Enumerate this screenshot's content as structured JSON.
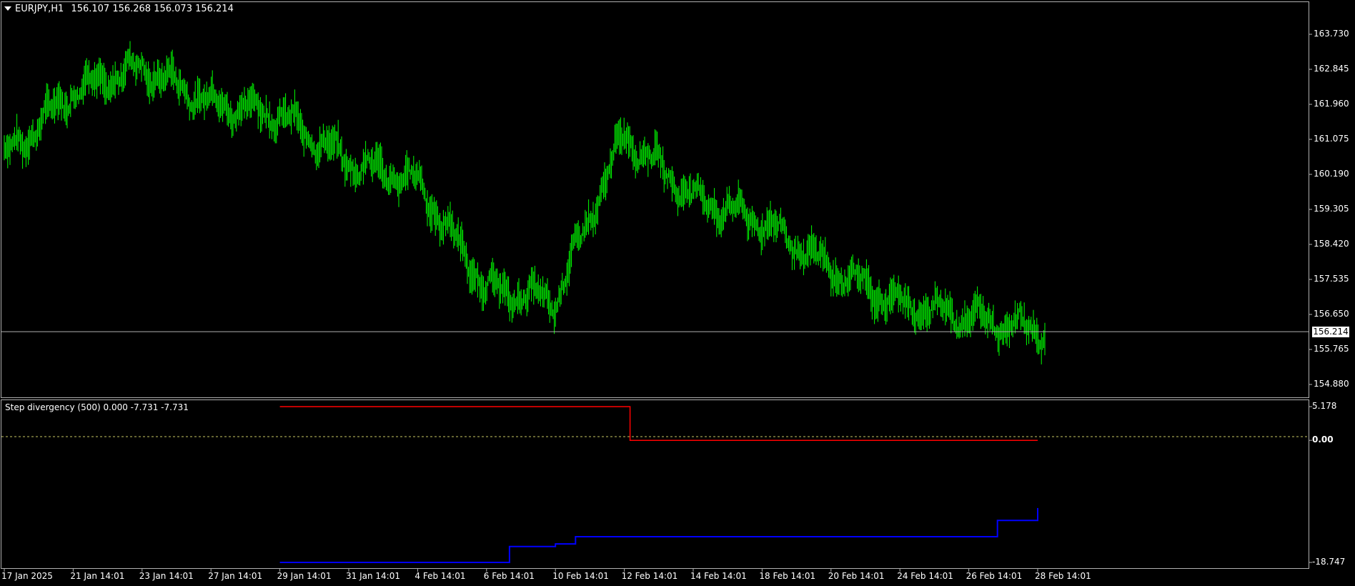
{
  "header": {
    "symbol": "EURJPY,H1",
    "ohlc": "156.107 156.268 156.073 156.214"
  },
  "indicator": {
    "title": "Step divergency (500) 0.000 -7.731 -7.731"
  },
  "colors": {
    "background": "#000000",
    "candles": "#00ff00",
    "upper_line": "#ff0000",
    "lower_line": "#0000ff",
    "grid": "#b0b0b0",
    "zero_line": "#c8c864"
  },
  "price_axis": {
    "ticks": [
      "163.730",
      "162.845",
      "161.960",
      "161.075",
      "160.190",
      "159.305",
      "158.420",
      "157.535",
      "156.650",
      "155.765",
      "154.880"
    ],
    "current_price": "156.214"
  },
  "indicator_axis": {
    "ticks": [
      "5.178",
      "0.00",
      "-18.747"
    ]
  },
  "time_axis": {
    "ticks": [
      "17 Jan 2025",
      "21 Jan 14:01",
      "23 Jan 14:01",
      "27 Jan 14:01",
      "29 Jan 14:01",
      "31 Jan 14:01",
      "4 Feb 14:01",
      "6 Feb 14:01",
      "10 Feb 14:01",
      "12 Feb 14:01",
      "14 Feb 14:01",
      "18 Feb 14:01",
      "20 Feb 14:01",
      "24 Feb 14:01",
      "26 Feb 14:01",
      "28 Feb 14:01"
    ]
  },
  "chart_data": [
    {
      "type": "line",
      "title": "EURJPY,H1",
      "series": [
        {
          "name": "EURJPY",
          "x": [
            "17 Jan 2025",
            "21 Jan 14:01",
            "23 Jan 14:01",
            "27 Jan 14:01",
            "29 Jan 14:01",
            "31 Jan 14:01",
            "4 Feb 14:01",
            "6 Feb 14:01",
            "10 Feb 14:01",
            "12 Feb 14:01",
            "14 Feb 14:01",
            "18 Feb 14:01",
            "20 Feb 14:01",
            "24 Feb 14:01",
            "26 Feb 14:01",
            "28 Feb 14:01"
          ],
          "values": [
            160.6,
            162.3,
            162.9,
            162.0,
            161.7,
            160.5,
            160.0,
            157.3,
            157.0,
            161.2,
            159.6,
            159.0,
            157.8,
            156.9,
            156.6,
            156.2
          ]
        }
      ],
      "ylim": [
        154.5,
        164.5
      ]
    },
    {
      "type": "line",
      "title": "Step divergency (500) 0.000 -7.731 -7.731",
      "series": [
        {
          "name": "",
          "x": [
            "29 Jan 14:01",
            "12 Feb 14:01",
            "12 Feb 18:00",
            "28 Feb 14:01"
          ],
          "values": [
            5.178,
            5.178,
            0.0,
            0.0
          ]
        },
        {
          "name": "",
          "x": [
            "29 Jan 14:01",
            "7 Feb 22:00",
            "10 Feb 14:01",
            "11 Feb 04:00",
            "26 Feb 14:01",
            "27 Feb 10:00",
            "28 Feb 14:01"
          ],
          "values": [
            -18.747,
            -16.3,
            -15.9,
            -14.8,
            -14.8,
            -12.3,
            -10.4
          ]
        }
      ],
      "ylim": [
        -18.747,
        5.178
      ]
    }
  ]
}
